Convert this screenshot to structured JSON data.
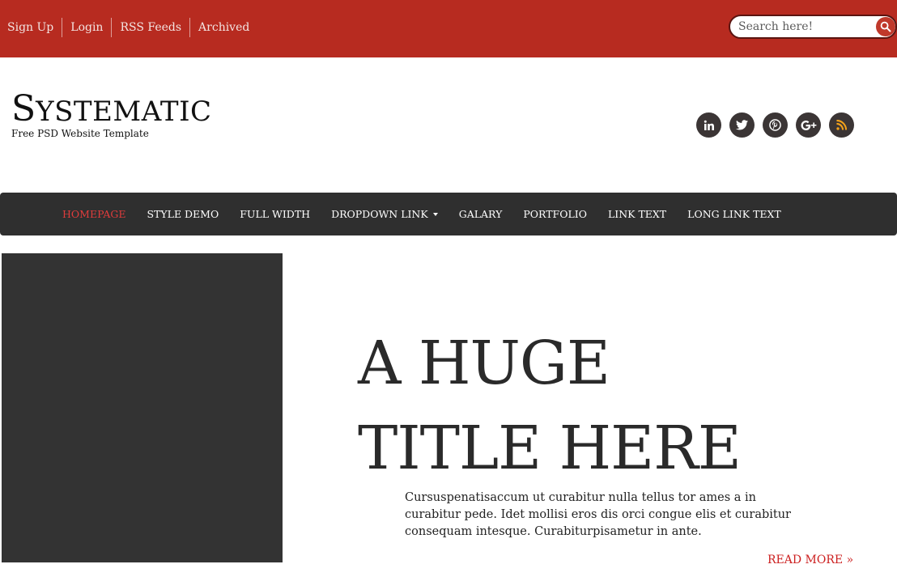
{
  "topbar": {
    "links": [
      "Sign Up",
      "Login",
      "RSS Feeds",
      "Archived"
    ],
    "search_placeholder": "Search here!",
    "colors": {
      "background": "#b72b20"
    }
  },
  "header": {
    "logo_first": "S",
    "logo_rest": "YSTEMATIC",
    "tagline": "Free PSD Website Template",
    "social_icons": [
      "linkedin-icon",
      "twitter-icon",
      "pinterest-icon",
      "google-plus-icon",
      "rss-icon"
    ]
  },
  "nav": {
    "items": [
      {
        "label": "HOMEPAGE",
        "active": true
      },
      {
        "label": "STYLE DEMO"
      },
      {
        "label": "FULL WIDTH"
      },
      {
        "label": "DROPDOWN LINK",
        "dropdown": true
      },
      {
        "label": "GALARY"
      },
      {
        "label": "PORTFOLIO"
      },
      {
        "label": "LINK TEXT"
      },
      {
        "label": "LONG LINK TEXT"
      }
    ],
    "colors": {
      "background": "#2f2f2f",
      "active": "#e03c3c"
    }
  },
  "hero": {
    "title_line1": "A HUGE",
    "title_line2": "TITLE HERE",
    "text": "Cursuspenatisaccum ut curabitur nulla tellus tor ames a in curabitur pede. Idet mollisi eros dis orci congue elis et curabitur consequam intesque. Curabiturpisametur in ante.",
    "read_more": "READ MORE »"
  }
}
